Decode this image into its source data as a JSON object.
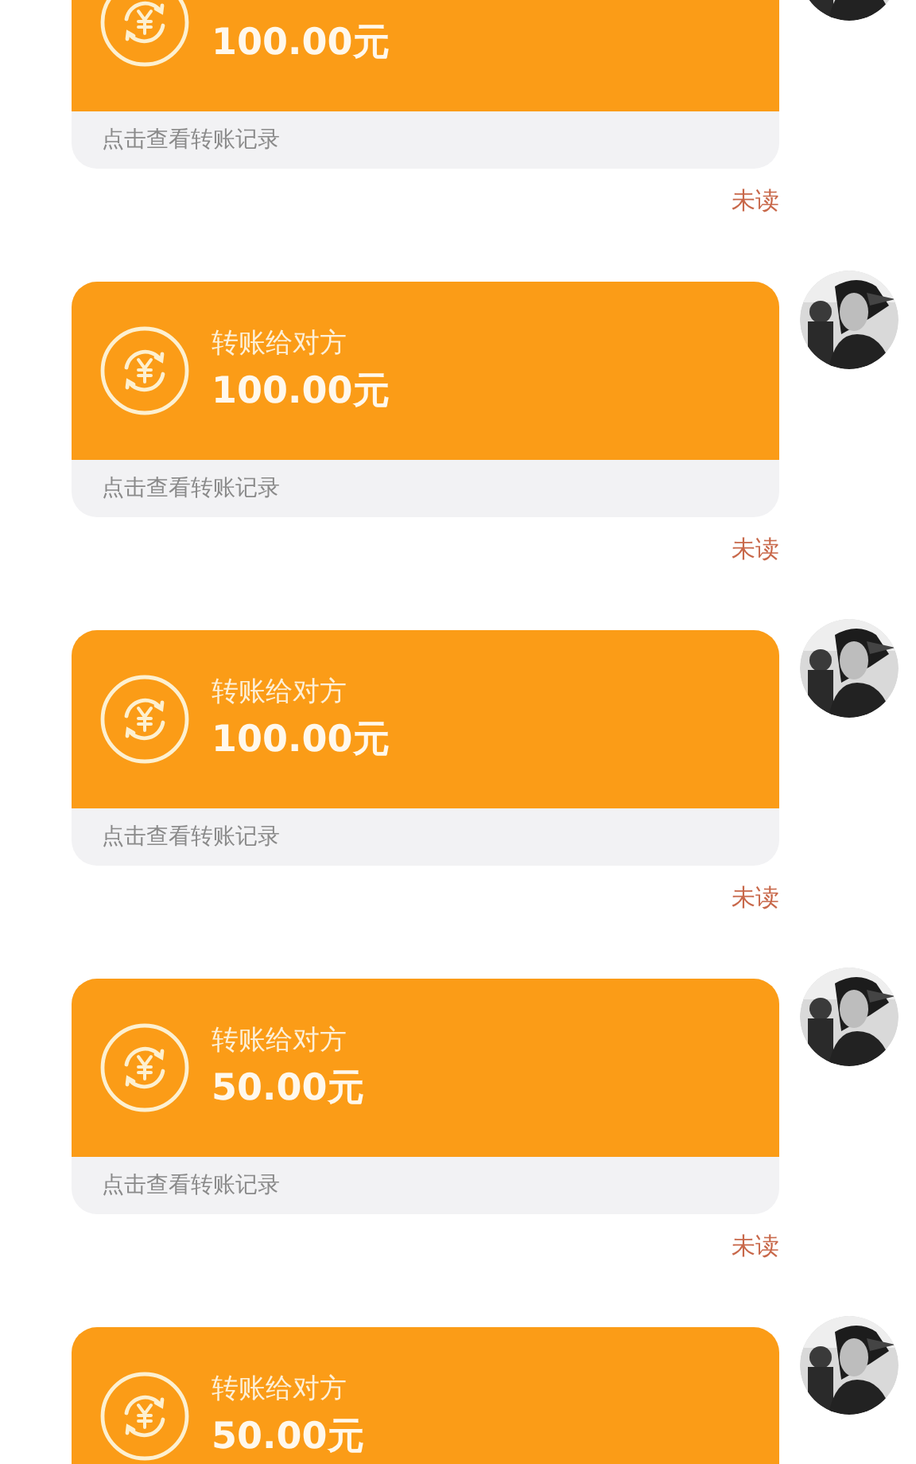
{
  "messages": [
    {
      "amount": "100.00元",
      "footer": "点击查看转账记录",
      "status": "未读"
    },
    {
      "title": "转账给对方",
      "amount": "100.00元",
      "footer": "点击查看转账记录",
      "status": "未读"
    },
    {
      "title": "转账给对方",
      "amount": "100.00元",
      "footer": "点击查看转账记录",
      "status": "未读"
    },
    {
      "title": "转账给对方",
      "amount": "50.00元",
      "footer": "点击查看转账记录",
      "status": "未读"
    },
    {
      "title": "转账给对方",
      "amount": "50.00元"
    }
  ]
}
